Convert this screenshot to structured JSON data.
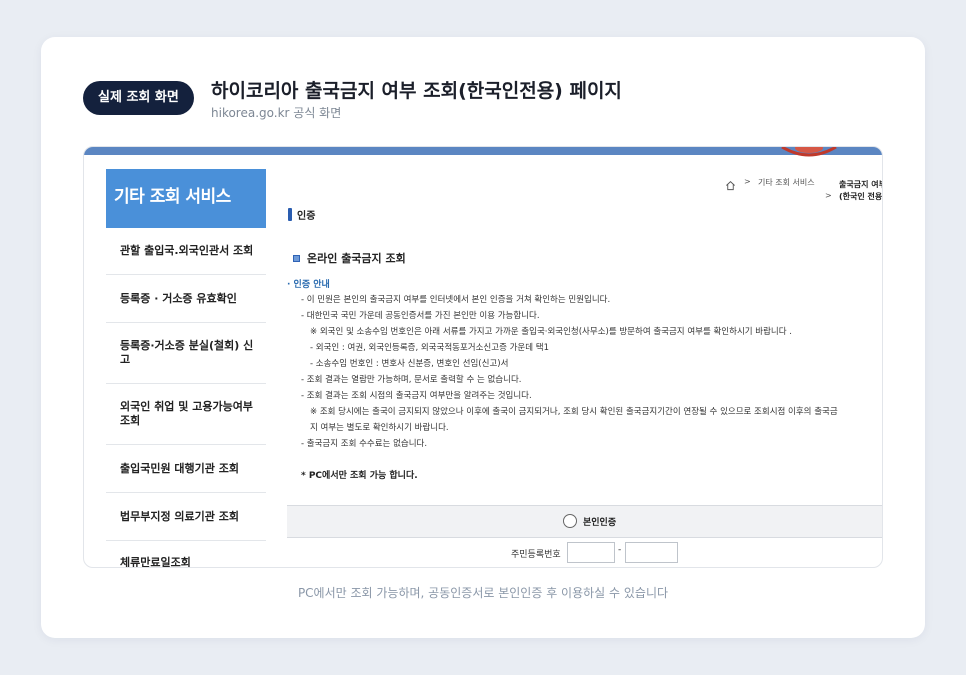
{
  "header": {
    "badge": "실제 조회 화면",
    "title": "하이코리아 출국금지 여부 조회(한국인전용) 페이지",
    "subtitle": "hikorea.go.kr 공식 화면"
  },
  "sidebar": {
    "title": "기타 조회 서비스",
    "items": [
      {
        "label": "관할 출입국.외국인관서 조회"
      },
      {
        "label": "등록증 · 거소증 유효확인"
      },
      {
        "label": "등록증·거소증 분실(철회) 신고"
      },
      {
        "label": "외국인 취업 및 고용가능여부 조회"
      },
      {
        "label": "출입국민원 대행기관 조회"
      },
      {
        "label": "법무부지정 의료기관 조회"
      },
      {
        "label": "체류만료일조회"
      }
    ]
  },
  "breadcrumb": {
    "home_icon": "home-icon",
    "separator": ">",
    "level1": "기타 조회 서비스",
    "current_line1": "출국금지 여부",
    "current_line2": "(한국인 전용)"
  },
  "section": {
    "title": "인증"
  },
  "content": {
    "online_title": "온라인 출국금지 조회",
    "guide_title": "· 인증 안내",
    "guide_lines": [
      "- 이 민원은 본인의 출국금지 여부를 인터넷에서 본인 인증을 거쳐 확인하는 민원입니다.",
      "- 대한민국 국민 가운데 공동인증서를 가진 본인만 이용 가능합니다.",
      "※ 외국인 및 소송수임 번호인은 아래 서류를 가지고 가까운 출입국·외국인청(사무소)를 방문하여 출국금지 여부를 확인하시기 바랍니다 .",
      "- 외국인 : 여권, 외국인등록증, 외국국적동포거소신고증 가운데 택1",
      "- 소송수임 번호인 : 변호사 신분증, 변호인 선임(신고)서",
      "- 조회 결과는 열람만 가능하며, 문서로 출력할 수 는 없습니다.",
      "- 조회 결과는 조회 시점의 출국금지 여부만을 알려주는 것입니다.",
      "※ 조회 당시에는 출국이 금지되지 않았으나 이후에 출국이 금지되거나, 조회 당시 확인된 출국금지기간이 연장될 수 있으므로 조회시점 이후의 출국금",
      "지 여부는 별도로 확인하시기 바랍니다.",
      "- 출국금지 조회 수수료는 없습니다."
    ],
    "pc_note": "* PC에서만 조회 가능 합니다."
  },
  "auth": {
    "option_label": "본인인증",
    "rrn_label": "주민등록번호",
    "rrn_dash": "-"
  },
  "caption": "PC에서만 조회 가능하며, 공동인증서로 본인인증 후 이용하실 수 있습니다",
  "colors": {
    "badge_bg": "#14213d",
    "sidebar_head": "#4a90d9",
    "top_bar": "#5b86c2",
    "guide_title": "#2b6cb0",
    "caption": "#8a97a8"
  }
}
